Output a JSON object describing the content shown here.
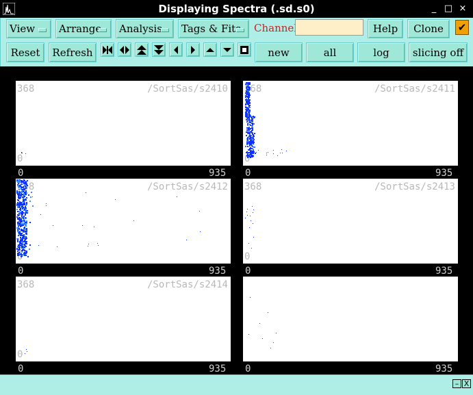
{
  "window": {
    "title": "Displaying Spectra (.sd.s0)",
    "min_glyph": "_",
    "max_glyph": "□",
    "close_glyph": "×"
  },
  "toolbar": {
    "menus": [
      "View",
      "Arrange",
      "Analysis",
      "Tags & Fits"
    ],
    "channel_label": "Channel:",
    "channel_value": "",
    "help": "Help",
    "clone": "Clone",
    "check_glyph": "✔",
    "reset": "Reset",
    "refresh": "Refresh",
    "new": "new",
    "all": "all",
    "log": "log",
    "slicing": "slicing off"
  },
  "nav_icons": [
    "expand-horizontal-icon",
    "compress-horizontal-icon",
    "expand-vertical-icon",
    "compress-vertical-icon",
    "left-icon",
    "right-icon",
    "up-icon",
    "down-icon",
    "stop-icon"
  ],
  "panels": [
    {
      "name": "/SortSas/s2410",
      "ymax": "368",
      "ymin": "0",
      "xmin": "0",
      "xmax": "935"
    },
    {
      "name": "/SortSas/s2411",
      "ymax": "368",
      "ymin": "0",
      "xmin": "0",
      "xmax": "935"
    },
    {
      "name": "/SortSas/s2412",
      "ymax": "368",
      "ymin": "0",
      "xmin": "0",
      "xmax": "935"
    },
    {
      "name": "/SortSas/s2413",
      "ymax": "368",
      "ymin": "0",
      "xmin": "0",
      "xmax": "935"
    },
    {
      "name": "/SortSas/s2414",
      "ymax": "368",
      "ymin": "0",
      "xmin": "0",
      "xmax": "935"
    },
    {
      "name": "",
      "ymax": "",
      "ymin": "",
      "xmin": "0",
      "xmax": "935"
    }
  ],
  "colors": {
    "accent": "#aeeee6",
    "button": "#9fe8d8",
    "channel_label": "#d02020",
    "plot_points": "#1030ff"
  },
  "status": {
    "minimize": "–",
    "close": "X"
  }
}
